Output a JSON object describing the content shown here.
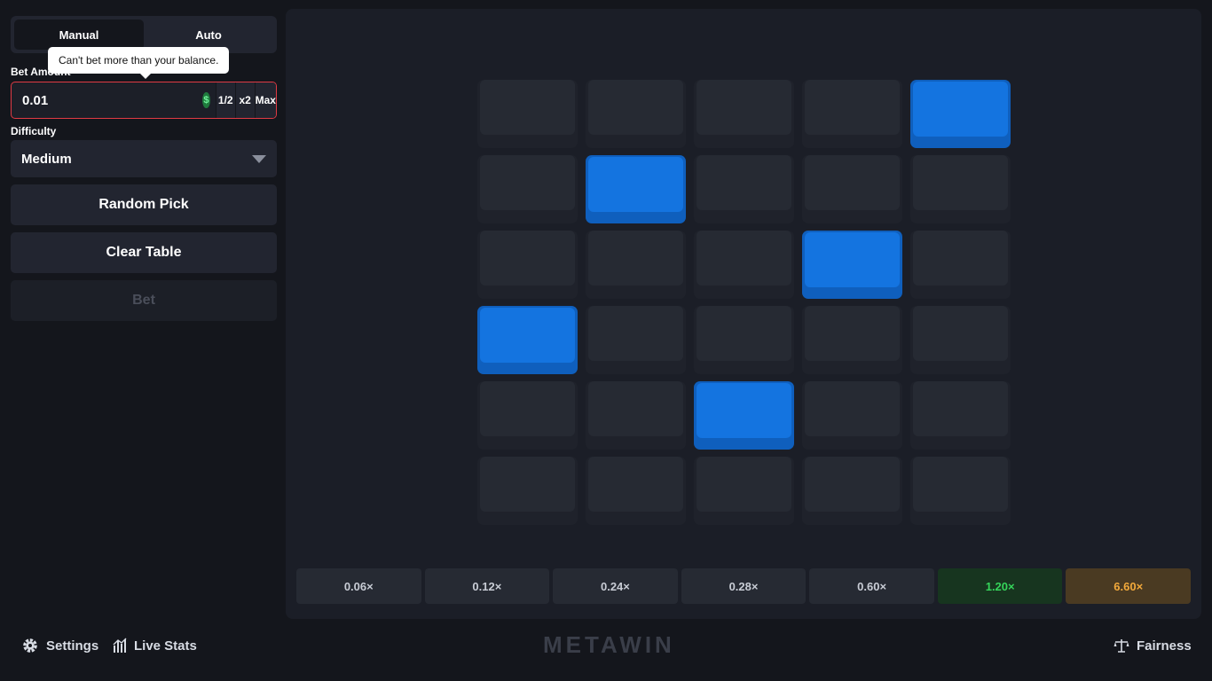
{
  "tabs": {
    "manual": "Manual",
    "auto": "Auto",
    "active": "manual"
  },
  "tooltip": {
    "text": "Can't bet more than your balance."
  },
  "bet": {
    "label": "Bet Amount",
    "value": "0.01",
    "currency_symbol": "$",
    "half_label": "1/2",
    "double_label": "x2",
    "max_label": "Max"
  },
  "difficulty": {
    "label": "Difficulty",
    "selected": "Medium"
  },
  "buttons": {
    "random_pick": "Random Pick",
    "clear_table": "Clear Table",
    "bet": "Bet"
  },
  "grid": {
    "rows": 6,
    "cols": 5,
    "selected": [
      [
        0,
        4
      ],
      [
        1,
        1
      ],
      [
        2,
        3
      ],
      [
        3,
        0
      ],
      [
        4,
        2
      ]
    ]
  },
  "multipliers": [
    {
      "label": "0.06×",
      "tone": "default"
    },
    {
      "label": "0.12×",
      "tone": "default"
    },
    {
      "label": "0.24×",
      "tone": "default"
    },
    {
      "label": "0.28×",
      "tone": "default"
    },
    {
      "label": "0.60×",
      "tone": "default"
    },
    {
      "label": "1.20×",
      "tone": "green"
    },
    {
      "label": "6.60×",
      "tone": "gold"
    }
  ],
  "footer": {
    "settings": "Settings",
    "live_stats": "Live Stats",
    "fairness": "Fairness",
    "logo": "METAWIN"
  },
  "colors": {
    "tile_selected": "#1474e0",
    "error_border": "#e03a44",
    "green": "#35d45a",
    "gold": "#f2a93b"
  }
}
